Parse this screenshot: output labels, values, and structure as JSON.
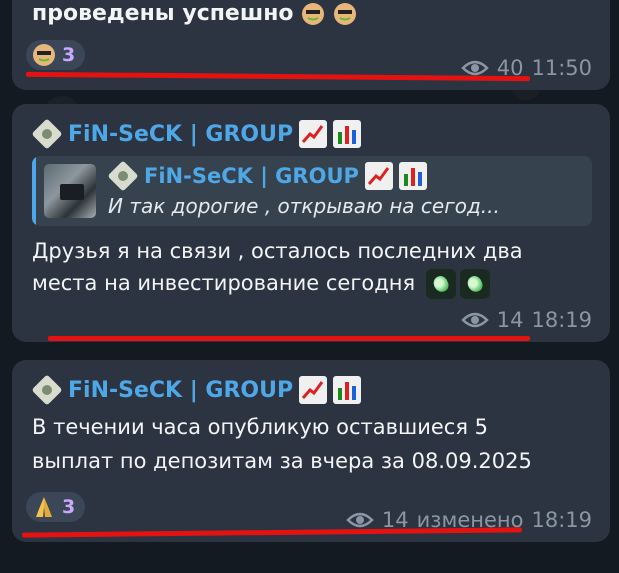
{
  "messages": [
    {
      "text": "проведены успешно",
      "reaction_count": "3",
      "views": "40",
      "time": "11:50"
    },
    {
      "sender": "FiN-SeCK | GROUP",
      "quote_sender": "FiN-SeCK | GROUP",
      "quote_text": "И так дорогие , открываю на сегод...",
      "line1": "Друзья я на связи , осталось последних два",
      "line2": "места на инвестирование сегодня",
      "views": "14",
      "time": "18:19"
    },
    {
      "sender": "FiN-SeCK | GROUP",
      "line1": "В течении часа опубликую оставшиеся 5",
      "line2": "выплат по депозитам за вчера за 08.09.2025",
      "reaction_count": "3",
      "views": "14",
      "edited": "изменено",
      "time": "18:19"
    }
  ],
  "icons": {
    "sender_avatar": "newspaper-icon",
    "chart_up": "chart-increasing-icon",
    "bar_chart": "bar-chart-icon",
    "views": "eye-icon",
    "reaction1": "money-mouth-face-icon",
    "reaction3": "folded-hands-icon"
  },
  "colors": {
    "bubble": "#2b3440",
    "accent": "#4ea8e8",
    "meta": "#8a96a3",
    "underline": "#e51212"
  }
}
